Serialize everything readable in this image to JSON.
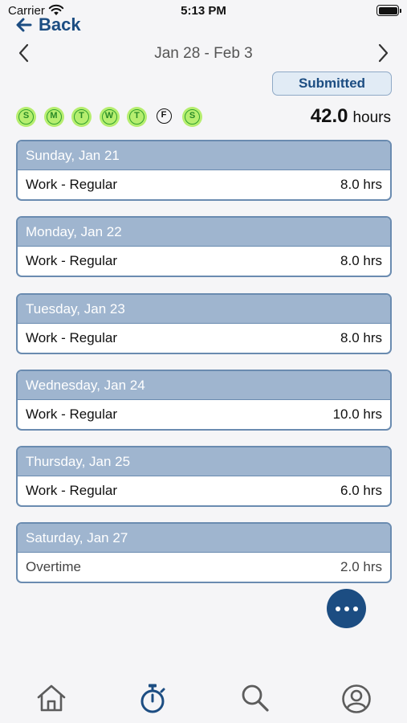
{
  "status_bar": {
    "carrier": "Carrier",
    "time": "5:13 PM",
    "battery_level": 1.0
  },
  "nav": {
    "back_label": "Back",
    "back_icon": "arrow-left-icon"
  },
  "week": {
    "range": "Jan 28 - Feb 3",
    "prev_icon": "chevron-left-icon",
    "next_icon": "chevron-right-icon"
  },
  "status_badge": "Submitted",
  "day_dots": [
    {
      "letter": "S",
      "has_time": true
    },
    {
      "letter": "M",
      "has_time": true
    },
    {
      "letter": "T",
      "has_time": true
    },
    {
      "letter": "W",
      "has_time": true
    },
    {
      "letter": "T",
      "has_time": true
    },
    {
      "letter": "F",
      "has_time": false
    },
    {
      "letter": "S",
      "has_time": true
    }
  ],
  "total": {
    "value": "42.0",
    "unit": "hours"
  },
  "days": [
    {
      "date": "Sunday, Jan 21",
      "type": "Work - Regular",
      "hours": "8.0 hrs"
    },
    {
      "date": "Monday, Jan 22",
      "type": "Work - Regular",
      "hours": "8.0 hrs"
    },
    {
      "date": "Tuesday, Jan 23",
      "type": "Work - Regular",
      "hours": "8.0 hrs"
    },
    {
      "date": "Wednesday, Jan 24",
      "type": "Work - Regular",
      "hours": "10.0 hrs"
    },
    {
      "date": "Thursday, Jan 25",
      "type": "Work - Regular",
      "hours": "6.0 hrs"
    },
    {
      "date": "Saturday, Jan 27",
      "type": "Overtime",
      "hours": "2.0 hrs"
    }
  ],
  "fab_icon": "more-horizontal-icon",
  "tabs": [
    {
      "icon": "home-icon",
      "active": false
    },
    {
      "icon": "stopwatch-icon",
      "active": true
    },
    {
      "icon": "search-icon",
      "active": false
    },
    {
      "icon": "profile-icon",
      "active": false
    }
  ],
  "colors": {
    "accent": "#1c4d82",
    "card_header": "#9fb5cf",
    "card_border": "#6a8bb0",
    "day_ok": "#b6ee6f",
    "day_ok_ring": "#32a22e",
    "tab_inactive": "#5c5c5c"
  }
}
